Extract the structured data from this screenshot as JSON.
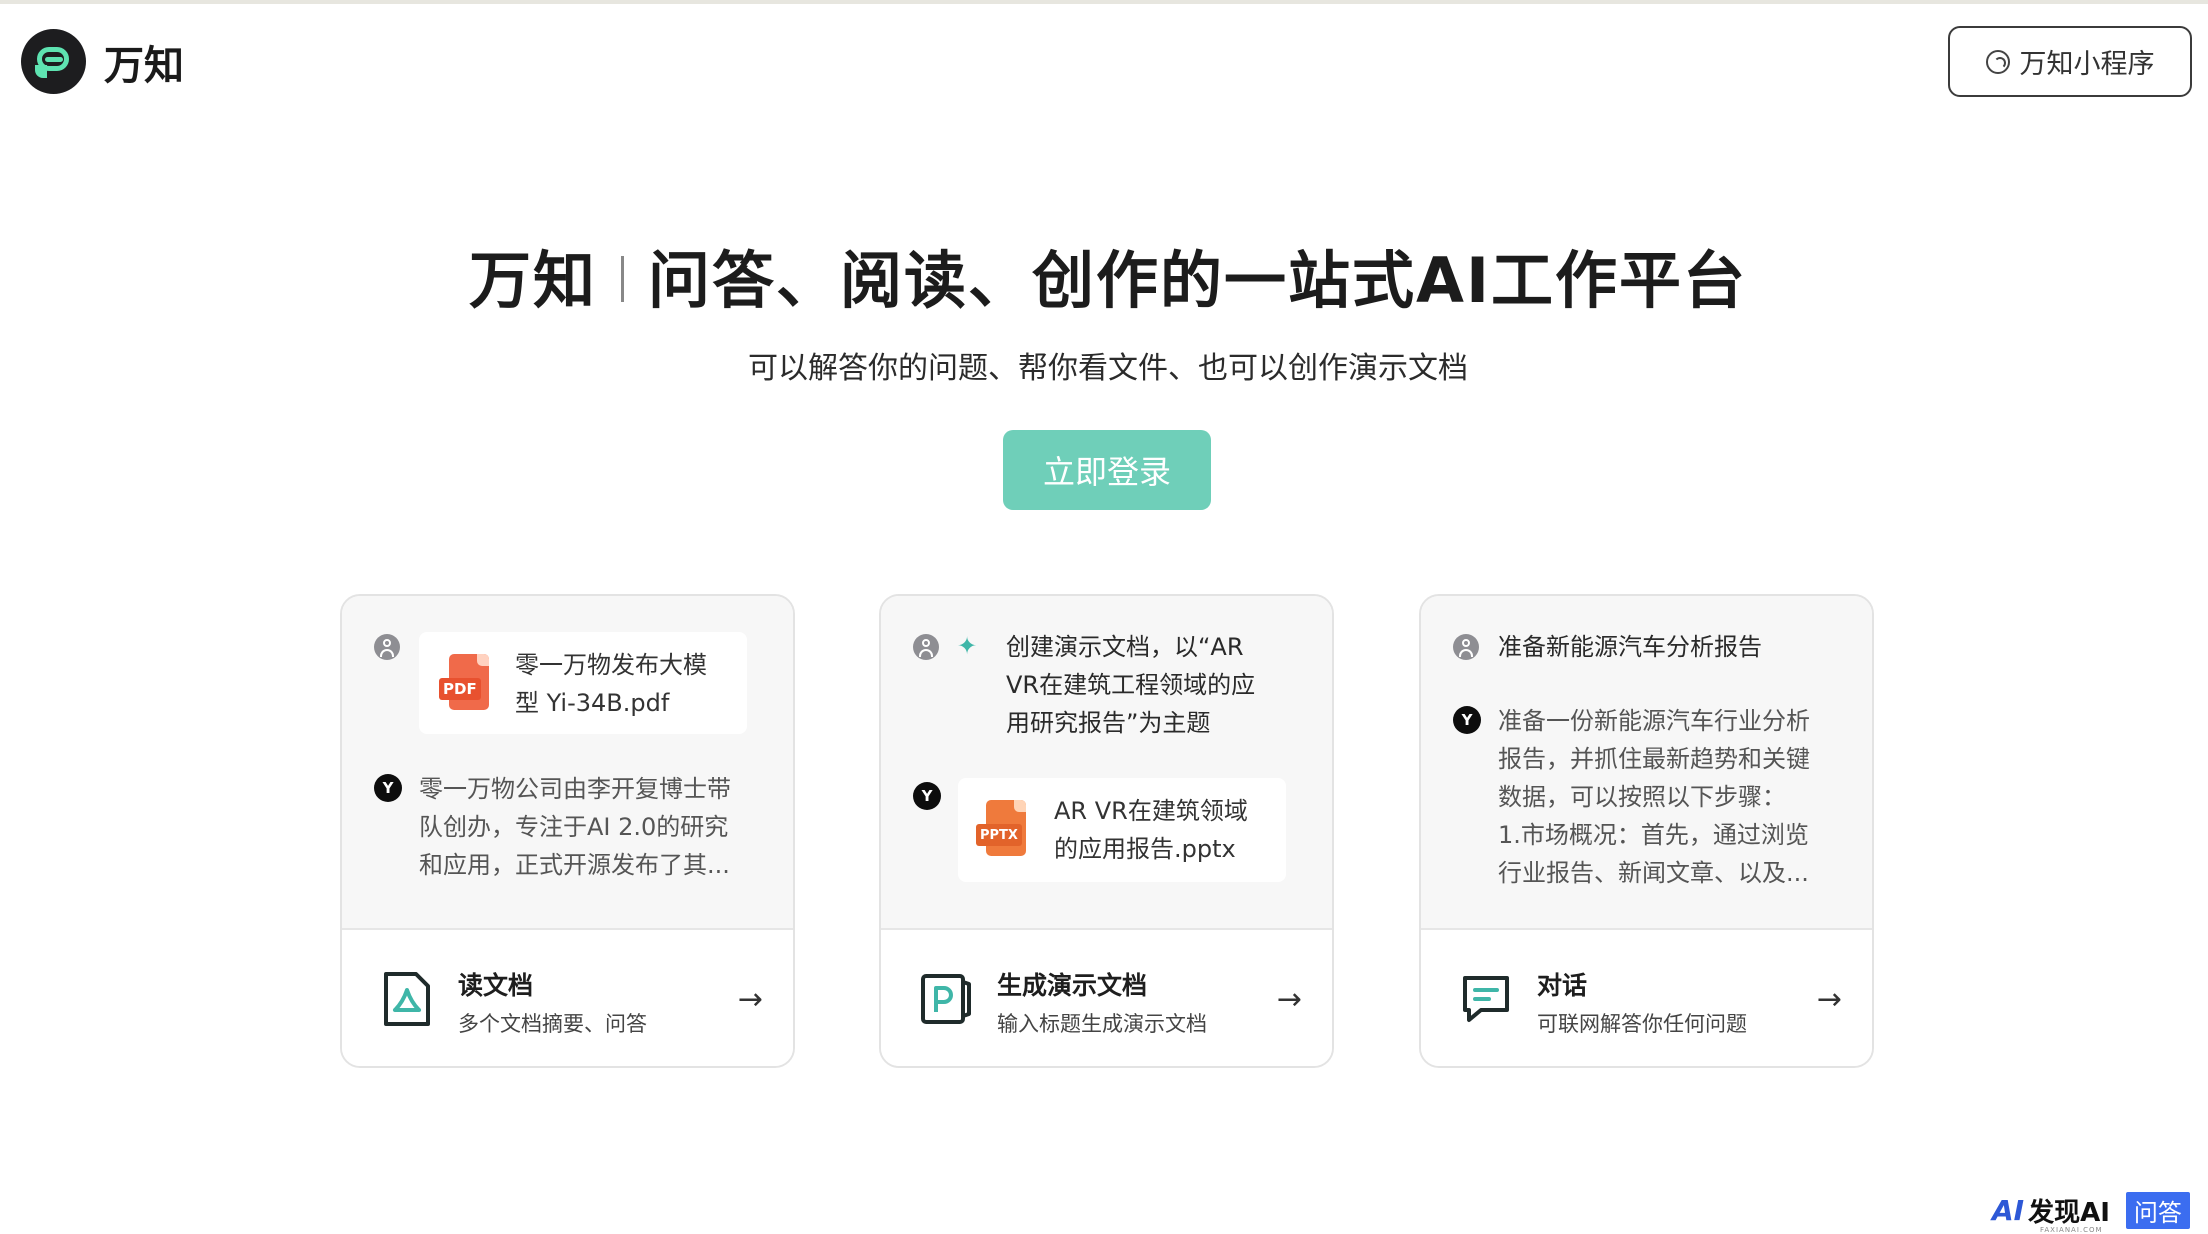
{
  "app": {
    "name": "万知"
  },
  "header": {
    "mini_program_label": "万知小程序"
  },
  "hero": {
    "title_brand": "万知",
    "title_main": "问答、阅读、创作的一站式AI工作平台",
    "subtitle": "可以解答你的问题、帮你看文件、也可以创作演示文档",
    "login_label": "立即登录"
  },
  "cards": [
    {
      "file_name_line1": "零一万物发布大模",
      "file_name_line2": "型 Yi-34B.pdf",
      "file_tag": "PDF",
      "answer_line1": "零一万物公司由李开复博士带",
      "answer_line2": "队创办，专注于AI 2.0的研究",
      "answer_line3": "和应用，正式开源发布了其...",
      "feature_title": "读文档",
      "feature_desc": "多个文档摘要、问答"
    },
    {
      "prompt_line1": "创建演示文档，以“AR",
      "prompt_line2": "VR在建筑工程领域的应",
      "prompt_line3": "用研究报告”为主题",
      "file_name_line1": "AR VR在建筑领域",
      "file_name_line2": "的应用报告.pptx",
      "file_tag": "PPTX",
      "feature_title": "生成演示文档",
      "feature_desc": "输入标题生成演示文档"
    },
    {
      "prompt": "准备新能源汽车分析报告",
      "answer_line1": "准备一份新能源汽车行业分析",
      "answer_line2": "报告，并抓住最新趋势和关键",
      "answer_line3": "数据，可以按照以下步骤：",
      "answer_line4": "1.市场概况：首先，通过浏览",
      "answer_line5": "行业报告、新闻文章、以及...",
      "feature_title": "对话",
      "feature_desc": "可联网解答你任何问题"
    }
  ],
  "bot_avatar_letter": "Y",
  "watermark": {
    "logo": "AI",
    "text": "发现AI",
    "badge": "问答",
    "small": "FAXIANAI.COM"
  },
  "colors": {
    "accent": "#6fcfb9",
    "logo_green": "#5ee3b1",
    "pdf": "#f06a4a",
    "pptx": "#ef7a3c"
  }
}
